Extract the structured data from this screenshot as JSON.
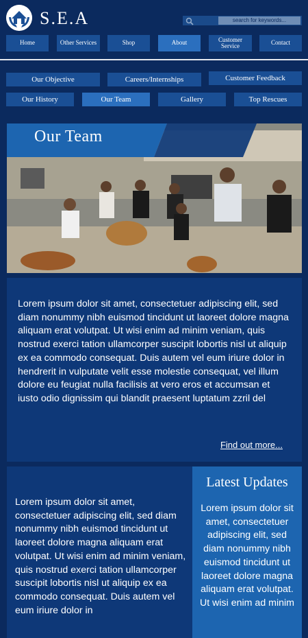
{
  "brand": {
    "name": "S.E.A"
  },
  "search": {
    "placeholder": "search for keywords..."
  },
  "nav": {
    "home": "Home",
    "other_services": "Other Services",
    "shop": "Shop",
    "about": "About",
    "customer_service": "Customer Service",
    "contact": "Contact"
  },
  "subnav": {
    "our_objective": "Our Objective",
    "careers": "Careers/Internships",
    "customer_feedback": "Customer Feedback",
    "our_history": "Our History",
    "our_team": "Our Team",
    "gallery": "Gallery",
    "top_rescues": "Top Rescues"
  },
  "hero": {
    "title": "Our Team"
  },
  "main_text": {
    "body": "Lorem ipsum dolor sit amet, consectetuer adipiscing elit, sed diam nonummy nibh euismod tincidunt ut laoreet dolore magna aliquam erat volutpat. Ut wisi enim ad minim veniam, quis nostrud exerci tation ullamcorper suscipit lobortis nisl ut aliquip ex ea commodo consequat. Duis autem vel eum iriure dolor in hendrerit in vulputate velit esse molestie consequat, vel illum dolore eu feugiat nulla facilisis at vero eros et accumsan et iusto odio dignissim qui blandit praesent luptatum zzril del",
    "link": "Find out more..."
  },
  "bottom_text": {
    "body": "Lorem ipsum dolor sit amet, consectetuer adipiscing elit, sed diam nonummy nibh euismod tincidunt ut laoreet dolore magna aliquam erat volutpat. Ut wisi enim ad minim veniam, quis nostrud exerci tation ullamcorper suscipit lobortis nisl ut aliquip ex ea commodo consequat. Duis autem vel eum iriure dolor in"
  },
  "updates": {
    "title": "Latest Updates",
    "body": "Lorem ipsum dolor sit amet, consectetuer adipiscing elit, sed diam nonummy nibh euismod tincidunt ut laoreet dolore magna aliquam erat volutpat. Ut wisi enim ad minim"
  },
  "colors": {
    "background": "#0b2a5e",
    "button": "#1a4f95",
    "button_active": "#2b6fbe",
    "panel": "#0e3878",
    "updates_panel": "#1d65b0"
  },
  "icons": {
    "logo": "house-hands-logo-icon",
    "search": "search-icon"
  }
}
